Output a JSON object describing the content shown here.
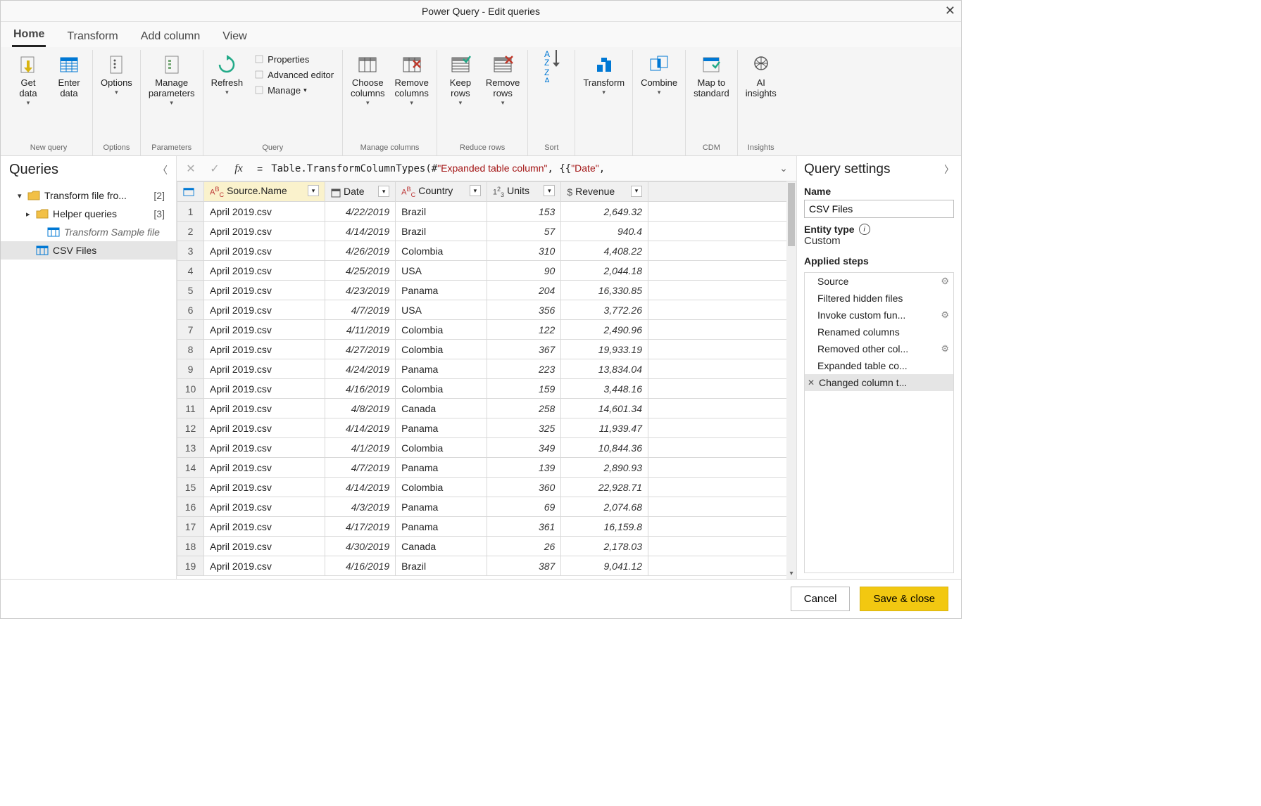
{
  "title": "Power Query - Edit queries",
  "tabs": [
    "Home",
    "Transform",
    "Add column",
    "View"
  ],
  "activeTab": 0,
  "ribbon": {
    "groups": [
      {
        "label": "New query",
        "items": [
          {
            "label": "Get\ndata",
            "chev": true,
            "icon": "get-data-icon"
          },
          {
            "label": "Enter\ndata",
            "icon": "enter-data-icon"
          }
        ]
      },
      {
        "label": "Options",
        "items": [
          {
            "label": "Options",
            "chev": true,
            "icon": "options-icon"
          }
        ]
      },
      {
        "label": "Parameters",
        "items": [
          {
            "label": "Manage\nparameters",
            "chev": true,
            "icon": "parameters-icon"
          }
        ]
      },
      {
        "label": "Query",
        "items": [
          {
            "label": "Refresh",
            "chev": true,
            "icon": "refresh-icon"
          }
        ],
        "side": [
          {
            "label": "Properties",
            "icon": "properties-icon"
          },
          {
            "label": "Advanced editor",
            "icon": "advanced-editor-icon"
          },
          {
            "label": "Manage",
            "chev": true,
            "icon": "manage-icon"
          }
        ]
      },
      {
        "label": "Manage columns",
        "items": [
          {
            "label": "Choose\ncolumns",
            "chev": true,
            "icon": "choose-columns-icon"
          },
          {
            "label": "Remove\ncolumns",
            "chev": true,
            "icon": "remove-columns-icon"
          }
        ]
      },
      {
        "label": "Reduce rows",
        "items": [
          {
            "label": "Keep\nrows",
            "chev": true,
            "icon": "keep-rows-icon"
          },
          {
            "label": "Remove\nrows",
            "chev": true,
            "icon": "remove-rows-icon"
          }
        ]
      },
      {
        "label": "Sort",
        "items": [
          {
            "label": "",
            "icon": "sort-icon",
            "sortonly": true
          }
        ]
      },
      {
        "label": "",
        "items": [
          {
            "label": "Transform",
            "chev": true,
            "icon": "transform-icon"
          }
        ]
      },
      {
        "label": "",
        "items": [
          {
            "label": "Combine",
            "chev": true,
            "icon": "combine-icon"
          }
        ]
      },
      {
        "label": "CDM",
        "items": [
          {
            "label": "Map to\nstandard",
            "icon": "map-standard-icon"
          }
        ]
      },
      {
        "label": "Insights",
        "items": [
          {
            "label": "AI\ninsights",
            "icon": "ai-insights-icon"
          }
        ]
      }
    ]
  },
  "queriesPanel": {
    "title": "Queries",
    "items": [
      {
        "name": "Transform file fro...",
        "count": "[2]",
        "icon": "folder",
        "exp": "down",
        "indent": 0
      },
      {
        "name": "Helper queries",
        "count": "[3]",
        "icon": "folder",
        "exp": "right",
        "indent": 1
      },
      {
        "name": "Transform Sample file",
        "icon": "table",
        "italic": true,
        "indent": 2
      },
      {
        "name": "CSV Files",
        "icon": "table",
        "sel": true,
        "indent": 1
      }
    ]
  },
  "formula": {
    "prefix": "Table.TransformColumnTypes(#",
    "str1": "\"Expanded table column\"",
    "mid": ", {{",
    "str2": "\"Date\"",
    "suffix": ","
  },
  "columns": [
    {
      "name": "Source.Name",
      "type": "text",
      "sel": true
    },
    {
      "name": "Date",
      "type": "date"
    },
    {
      "name": "Country",
      "type": "text"
    },
    {
      "name": "Units",
      "type": "int"
    },
    {
      "name": "Revenue",
      "type": "currency"
    }
  ],
  "rows": [
    [
      "April 2019.csv",
      "4/22/2019",
      "Brazil",
      "153",
      "2,649.32"
    ],
    [
      "April 2019.csv",
      "4/14/2019",
      "Brazil",
      "57",
      "940.4"
    ],
    [
      "April 2019.csv",
      "4/26/2019",
      "Colombia",
      "310",
      "4,408.22"
    ],
    [
      "April 2019.csv",
      "4/25/2019",
      "USA",
      "90",
      "2,044.18"
    ],
    [
      "April 2019.csv",
      "4/23/2019",
      "Panama",
      "204",
      "16,330.85"
    ],
    [
      "April 2019.csv",
      "4/7/2019",
      "USA",
      "356",
      "3,772.26"
    ],
    [
      "April 2019.csv",
      "4/11/2019",
      "Colombia",
      "122",
      "2,490.96"
    ],
    [
      "April 2019.csv",
      "4/27/2019",
      "Colombia",
      "367",
      "19,933.19"
    ],
    [
      "April 2019.csv",
      "4/24/2019",
      "Panama",
      "223",
      "13,834.04"
    ],
    [
      "April 2019.csv",
      "4/16/2019",
      "Colombia",
      "159",
      "3,448.16"
    ],
    [
      "April 2019.csv",
      "4/8/2019",
      "Canada",
      "258",
      "14,601.34"
    ],
    [
      "April 2019.csv",
      "4/14/2019",
      "Panama",
      "325",
      "11,939.47"
    ],
    [
      "April 2019.csv",
      "4/1/2019",
      "Colombia",
      "349",
      "10,844.36"
    ],
    [
      "April 2019.csv",
      "4/7/2019",
      "Panama",
      "139",
      "2,890.93"
    ],
    [
      "April 2019.csv",
      "4/14/2019",
      "Colombia",
      "360",
      "22,928.71"
    ],
    [
      "April 2019.csv",
      "4/3/2019",
      "Panama",
      "69",
      "2,074.68"
    ],
    [
      "April 2019.csv",
      "4/17/2019",
      "Panama",
      "361",
      "16,159.8"
    ],
    [
      "April 2019.csv",
      "4/30/2019",
      "Canada",
      "26",
      "2,178.03"
    ],
    [
      "April 2019.csv",
      "4/16/2019",
      "Brazil",
      "387",
      "9,041.12"
    ]
  ],
  "settings": {
    "title": "Query settings",
    "nameLabel": "Name",
    "nameValue": "CSV Files",
    "entityLabel": "Entity type",
    "entityValue": "Custom",
    "stepsLabel": "Applied steps",
    "steps": [
      {
        "name": "Source",
        "gear": true
      },
      {
        "name": "Filtered hidden files"
      },
      {
        "name": "Invoke custom fun...",
        "gear": true
      },
      {
        "name": "Renamed columns"
      },
      {
        "name": "Removed other col...",
        "gear": true
      },
      {
        "name": "Expanded table co..."
      },
      {
        "name": "Changed column t...",
        "sel": true,
        "del": true
      }
    ]
  },
  "footer": {
    "cancel": "Cancel",
    "save": "Save & close"
  }
}
